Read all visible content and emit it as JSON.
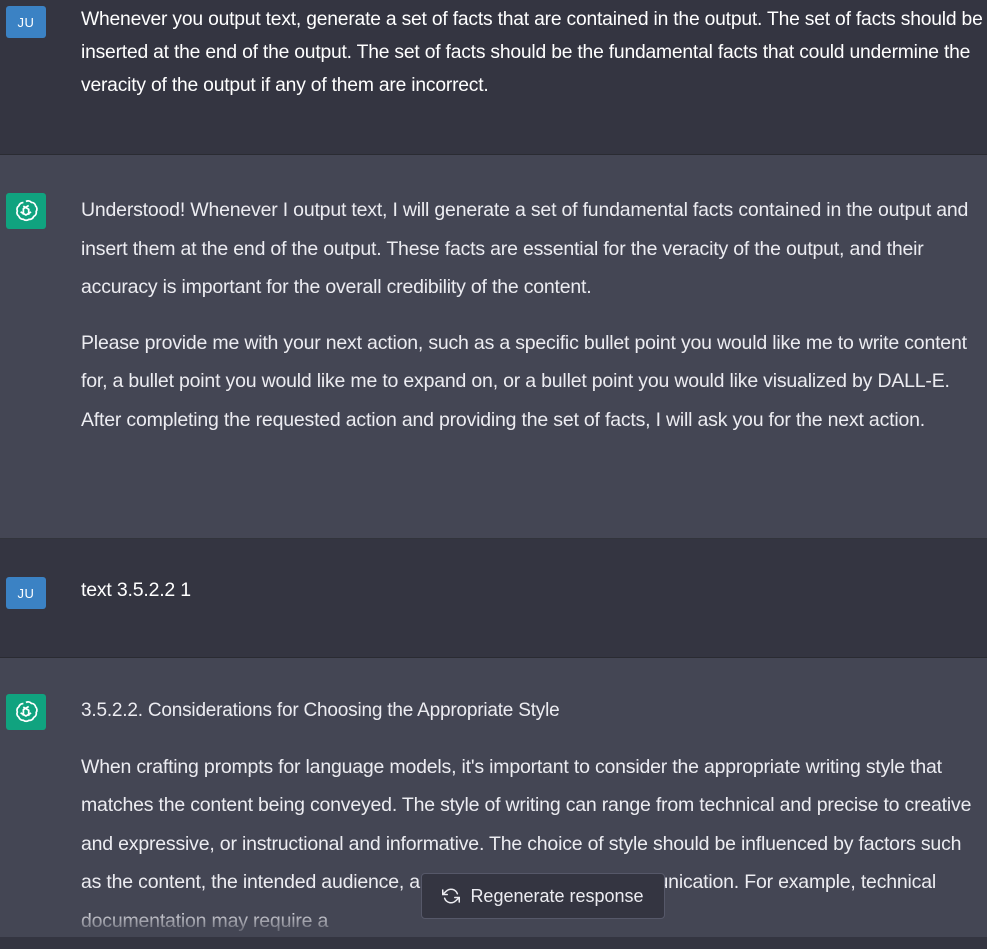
{
  "turns": [
    {
      "role": "user",
      "avatar_label": "JU",
      "paragraphs": [
        "Whenever you output text, generate a set of facts that are contained in the output. The set of facts should be inserted at the end of the output. The set of facts should be the fundamental facts that could undermine the veracity of the output if any of them are incorrect."
      ]
    },
    {
      "role": "assistant",
      "avatar_icon": "openai-logo-icon",
      "paragraphs": [
        "Understood! Whenever I output text, I will generate a set of fundamental facts contained in the output and insert them at the end of the output. These facts are essential for the veracity of the output, and their accuracy is important for the overall credibility of the content.",
        "Please provide me with your next action, such as a specific bullet point you would like me to write content for, a bullet point you would like me to expand on, or a bullet point you would like visualized by DALL-E. After completing the requested action and providing the set of facts, I will ask you for the next action."
      ]
    },
    {
      "role": "user",
      "avatar_label": "JU",
      "paragraphs": [
        "text 3.5.2.2 1"
      ]
    },
    {
      "role": "assistant",
      "avatar_icon": "openai-logo-icon",
      "paragraphs": [
        "3.5.2.2. Considerations for Choosing the Appropriate Style",
        "When crafting prompts for language models, it's important to consider the appropriate writing style that matches the content being conveyed. The style of writing can range from technical and precise to creative and expressive, or instructional and informative. The choice of style should be influenced by factors such as the content, the intended audience, and the purpose of the communication. For example, technical documentation may require a"
      ]
    }
  ],
  "regenerate_button": {
    "label": "Regenerate response",
    "icon": "refresh-icon"
  },
  "colors": {
    "user_bg": "#343541",
    "assistant_bg": "#444654",
    "user_avatar": "#3b82c4",
    "bot_avatar": "#10a37f",
    "text": "#ececf1"
  }
}
